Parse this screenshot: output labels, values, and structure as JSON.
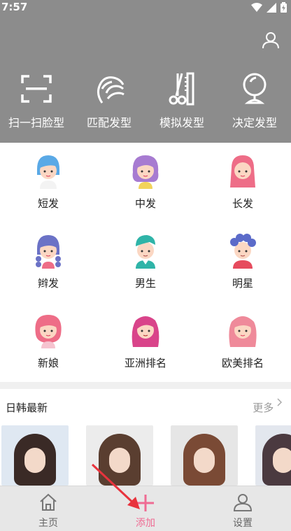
{
  "status": {
    "time": "7:57"
  },
  "colors": {
    "header_bg": "#8c8c8c",
    "accent": "#ef6b93"
  },
  "quick_actions": [
    {
      "label": "扫一扫脸型",
      "icon": "scan-icon"
    },
    {
      "label": "匹配发型",
      "icon": "hair-icon"
    },
    {
      "label": "模拟发型",
      "icon": "scissors-comb-icon"
    },
    {
      "label": "决定发型",
      "icon": "mirror-icon"
    }
  ],
  "categories": [
    {
      "label": "短发",
      "icon": "short-hair-avatar-icon"
    },
    {
      "label": "中发",
      "icon": "medium-hair-avatar-icon"
    },
    {
      "label": "长发",
      "icon": "long-hair-avatar-icon"
    },
    {
      "label": "辫发",
      "icon": "braid-hair-avatar-icon"
    },
    {
      "label": "男生",
      "icon": "male-avatar-icon"
    },
    {
      "label": "明星",
      "icon": "star-avatar-icon"
    },
    {
      "label": "新娘",
      "icon": "bride-avatar-icon"
    },
    {
      "label": "亚洲排名",
      "icon": "asian-ranking-avatar-icon"
    },
    {
      "label": "欧美排名",
      "icon": "western-ranking-avatar-icon"
    }
  ],
  "section": {
    "title": "日韩最新",
    "more": "更多"
  },
  "tabs": [
    {
      "label": "主页",
      "icon": "home-icon"
    },
    {
      "label": "添加",
      "icon": "plus-icon"
    },
    {
      "label": "设置",
      "icon": "user-icon"
    }
  ]
}
